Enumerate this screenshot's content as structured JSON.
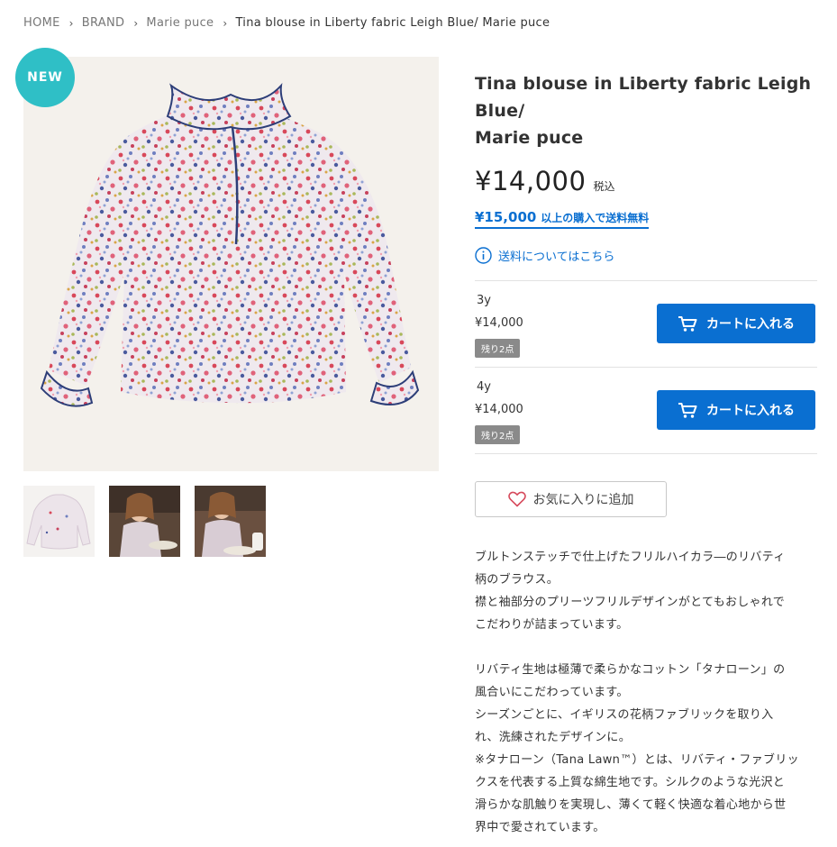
{
  "breadcrumb": {
    "home": "HOME",
    "brand": "BRAND",
    "maker": "Marie puce",
    "current": "Tina blouse in Liberty fabric Leigh Blue/ Marie puce"
  },
  "badge": {
    "label": "NEW",
    "color": "#2fbfc6"
  },
  "product": {
    "title_line1": "Tina blouse in Liberty fabric Leigh Blue/",
    "title_line2": "Marie puce",
    "price": "¥14,000",
    "tax_label": "税込"
  },
  "shipping": {
    "free_amount": "¥15,000",
    "free_text": "以上の購入で送料無料",
    "info_link": "送料についてはこちら"
  },
  "variants": [
    {
      "size": "3y",
      "price": "¥14,000",
      "stock": "残り2点",
      "cart_label": "カートに入れる"
    },
    {
      "size": "4y",
      "price": "¥14,000",
      "stock": "残り2点",
      "cart_label": "カートに入れる"
    }
  ],
  "favorite": {
    "label": "お気に入りに追加"
  },
  "description": [
    "ブルトンステッチで仕上げたフリルハイカラ―のリバティ",
    "柄のブラウス。",
    "襟と袖部分のプリーツフリルデザインがとてもおしゃれで",
    "こだわりが詰まっています。",
    "",
    "リバティ生地は極薄で柔らかなコットン「タナローン」の",
    "風合いにこだわっています。",
    "シーズンごとに、イギリスの花柄ファブリックを取り入",
    "れ、洗練されたデザインに。",
    "※タナローン（Tana Lawn™）とは、リバティ・ファブリッ",
    "クスを代表する上質な綿生地です。シルクのような光沢と",
    "滑らかな肌触りを実現し、薄くて軽く快適な着心地から世",
    "界中で愛されています。"
  ],
  "colors": {
    "accent": "#0a6fd1",
    "stock_badge": "#8a8a8a",
    "image_bg": "#f4f1ec"
  }
}
